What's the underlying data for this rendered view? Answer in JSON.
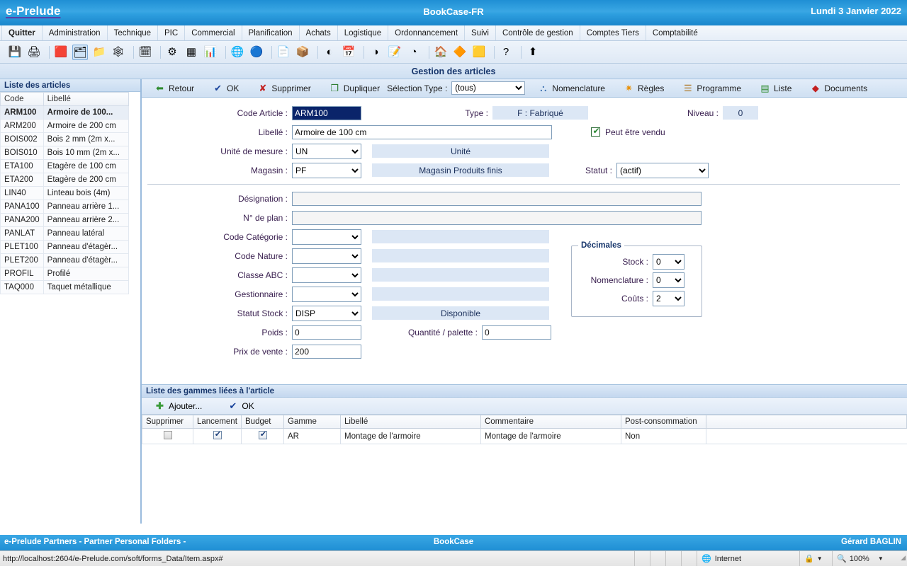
{
  "titlebar": {
    "brand": "e-Prelude",
    "center": "BookCase-FR",
    "date": "Lundi 3 Janvier 2022"
  },
  "menubar": {
    "items": [
      {
        "label": "Quitter"
      },
      {
        "label": "Administration"
      },
      {
        "label": "Technique"
      },
      {
        "label": "PIC"
      },
      {
        "label": "Commercial"
      },
      {
        "label": "Planification"
      },
      {
        "label": "Achats"
      },
      {
        "label": "Logistique"
      },
      {
        "label": "Ordonnancement"
      },
      {
        "label": "Suivi"
      },
      {
        "label": "Contrôle de gestion"
      },
      {
        "label": "Comptes Tiers"
      },
      {
        "label": "Comptabilité"
      }
    ]
  },
  "toolbar": {
    "icons": [
      {
        "name": "save-icon",
        "glyph": "💾",
        "selected": false
      },
      {
        "name": "print-icon",
        "glyph": "🖨",
        "selected": false
      },
      {
        "name": "sep",
        "glyph": "",
        "selected": false
      },
      {
        "name": "clients-icon",
        "glyph": "🟥",
        "selected": false
      },
      {
        "name": "articles-icon",
        "glyph": "🗂",
        "selected": true
      },
      {
        "name": "folder-articles-icon",
        "glyph": "📁",
        "selected": false
      },
      {
        "name": "nomenclature-icon",
        "glyph": "🕸",
        "selected": false
      },
      {
        "name": "sep",
        "glyph": "",
        "selected": false
      },
      {
        "name": "planning-icon",
        "glyph": "🗓",
        "selected": false
      },
      {
        "name": "sep",
        "glyph": "",
        "selected": false
      },
      {
        "name": "schedule-icon",
        "glyph": "⚙",
        "selected": false
      },
      {
        "name": "grid-icon",
        "glyph": "▦",
        "selected": false
      },
      {
        "name": "chart-icon",
        "glyph": "📊",
        "selected": false
      },
      {
        "name": "sep",
        "glyph": "",
        "selected": false
      },
      {
        "name": "globe-blue-icon",
        "glyph": "🌐",
        "selected": false
      },
      {
        "name": "globe-dark-icon",
        "glyph": "🔵",
        "selected": false
      },
      {
        "name": "sep",
        "glyph": "",
        "selected": false
      },
      {
        "name": "order-icon",
        "glyph": "📄",
        "selected": false
      },
      {
        "name": "boxes-icon",
        "glyph": "📦",
        "selected": false
      },
      {
        "name": "sep",
        "glyph": "",
        "selected": false
      },
      {
        "name": "meter-icon",
        "glyph": "◐",
        "selected": false
      },
      {
        "name": "calendar-grid-icon",
        "glyph": "📅",
        "selected": false
      },
      {
        "name": "sep",
        "glyph": "",
        "selected": false
      },
      {
        "name": "meter2-icon",
        "glyph": "◑",
        "selected": false
      },
      {
        "name": "edit-doc-icon",
        "glyph": "📝",
        "selected": false
      },
      {
        "name": "meter3-icon",
        "glyph": "◔",
        "selected": false
      },
      {
        "name": "sep",
        "glyph": "",
        "selected": false
      },
      {
        "name": "house-icon",
        "glyph": "🏠",
        "selected": false
      },
      {
        "name": "blocks-icon",
        "glyph": "🔶",
        "selected": false
      },
      {
        "name": "export-icon",
        "glyph": "🟨",
        "selected": false
      },
      {
        "name": "sep",
        "glyph": "",
        "selected": false
      },
      {
        "name": "help-icon",
        "glyph": "?",
        "selected": false
      },
      {
        "name": "sep",
        "glyph": "",
        "selected": false
      },
      {
        "name": "up-arrow-icon",
        "glyph": "⬆",
        "selected": false
      }
    ]
  },
  "page": {
    "title": "Gestion des articles"
  },
  "sidebar": {
    "header": "Liste des articles",
    "columns": [
      "Code",
      "Libellé"
    ],
    "rows": [
      {
        "code": "ARM100",
        "label": "Armoire de 100...",
        "selected": true
      },
      {
        "code": "ARM200",
        "label": "Armoire de 200 cm",
        "selected": false
      },
      {
        "code": "BOIS002",
        "label": "Bois 2 mm (2m x...",
        "selected": false
      },
      {
        "code": "BOIS010",
        "label": "Bois 10 mm (2m x...",
        "selected": false
      },
      {
        "code": "ETA100",
        "label": "Etagère de 100 cm",
        "selected": false
      },
      {
        "code": "ETA200",
        "label": "Etagère de 200 cm",
        "selected": false
      },
      {
        "code": "LIN40",
        "label": "Linteau bois (4m)",
        "selected": false
      },
      {
        "code": "PANA100",
        "label": "Panneau arrière 1...",
        "selected": false
      },
      {
        "code": "PANA200",
        "label": "Panneau arrière 2...",
        "selected": false
      },
      {
        "code": "PANLAT",
        "label": "Panneau latéral",
        "selected": false
      },
      {
        "code": "PLET100",
        "label": "Panneau d'étagèr...",
        "selected": false
      },
      {
        "code": "PLET200",
        "label": "Panneau d'étagèr...",
        "selected": false
      },
      {
        "code": "PROFIL",
        "label": "Profilé",
        "selected": false
      },
      {
        "code": "TAQ000",
        "label": "Taquet métallique",
        "selected": false
      }
    ]
  },
  "actionbar": {
    "back": "Retour",
    "ok": "OK",
    "delete": "Supprimer",
    "duplicate": "Dupliquer",
    "selection_type_label": "Sélection Type :",
    "selection_type_value": "(tous)",
    "selection_type_options": [
      "(tous)"
    ],
    "nomenclature": "Nomenclature",
    "rules": "Règles",
    "program": "Programme",
    "list": "Liste",
    "documents": "Documents"
  },
  "form": {
    "code_article_label": "Code Article :",
    "code_article_value": "ARM100",
    "type_label": "Type :",
    "type_value": "F : Fabriqué",
    "niveau_label": "Niveau :",
    "niveau_value": "0",
    "libelle_label": "Libellé :",
    "libelle_value": "Armoire de 100 cm",
    "peut_etre_vendu_label": "Peut être vendu",
    "peut_etre_vendu_checked": true,
    "unite_mesure_label": "Unité de mesure :",
    "unite_mesure_value": "UN",
    "unite_mesure_desc": "Unité",
    "magasin_label": "Magasin :",
    "magasin_value": "PF",
    "magasin_desc": "Magasin Produits finis",
    "statut_label": "Statut :",
    "statut_value": "(actif)",
    "designation_label": "Désignation :",
    "designation_value": "",
    "plan_label": "N° de plan :",
    "plan_value": "",
    "code_categorie_label": "Code Catégorie :",
    "code_categorie_value": "",
    "code_categorie_desc": "",
    "code_nature_label": "Code Nature :",
    "code_nature_value": "",
    "code_nature_desc": "",
    "classe_abc_label": "Classe ABC :",
    "classe_abc_value": "",
    "classe_abc_desc": "",
    "gestionnaire_label": "Gestionnaire :",
    "gestionnaire_value": "",
    "gestionnaire_desc": "",
    "statut_stock_label": "Statut Stock :",
    "statut_stock_value": "DISP",
    "statut_stock_desc": "Disponible",
    "poids_label": "Poids :",
    "poids_value": "0",
    "quantite_palette_label": "Quantité / palette :",
    "quantite_palette_value": "0",
    "prix_vente_label": "Prix de vente :",
    "prix_vente_value": "200",
    "decimales": {
      "legend": "Décimales",
      "stock_label": "Stock :",
      "stock_value": "0",
      "nomenclature_label": "Nomenclature :",
      "nomenclature_value": "0",
      "couts_label": "Coûts :",
      "couts_value": "2"
    }
  },
  "gammes": {
    "header": "Liste des gammes liées à l'article",
    "add_label": "Ajouter...",
    "ok_label": "OK",
    "columns": [
      "Supprimer",
      "Lancement",
      "Budget",
      "Gamme",
      "Libellé",
      "Commentaire",
      "Post-consommation",
      ""
    ],
    "rows": [
      {
        "supprimer": false,
        "lancement": true,
        "budget": true,
        "gamme": "AR",
        "libelle": "Montage de l'armoire",
        "commentaire": "Montage de l'armoire",
        "post_consommation": "Non"
      }
    ]
  },
  "footer": {
    "left": "e-Prelude Partners - Partner Personal Folders -",
    "center": "BookCase",
    "right": "Gérard BAGLIN"
  },
  "statusbar": {
    "url": "http://localhost:2604/e-Prelude.com/soft/forms_Data/Item.aspx#",
    "zone": "Internet",
    "zoom": "100%"
  },
  "colors": {
    "brand_blue": "#1f8fd4",
    "band_blue": "#cfe0f2",
    "title_navy": "#16356b",
    "label_purple": "#3a2050",
    "flat_field": "#dce7f5",
    "selection_navy": "#0a246a"
  }
}
